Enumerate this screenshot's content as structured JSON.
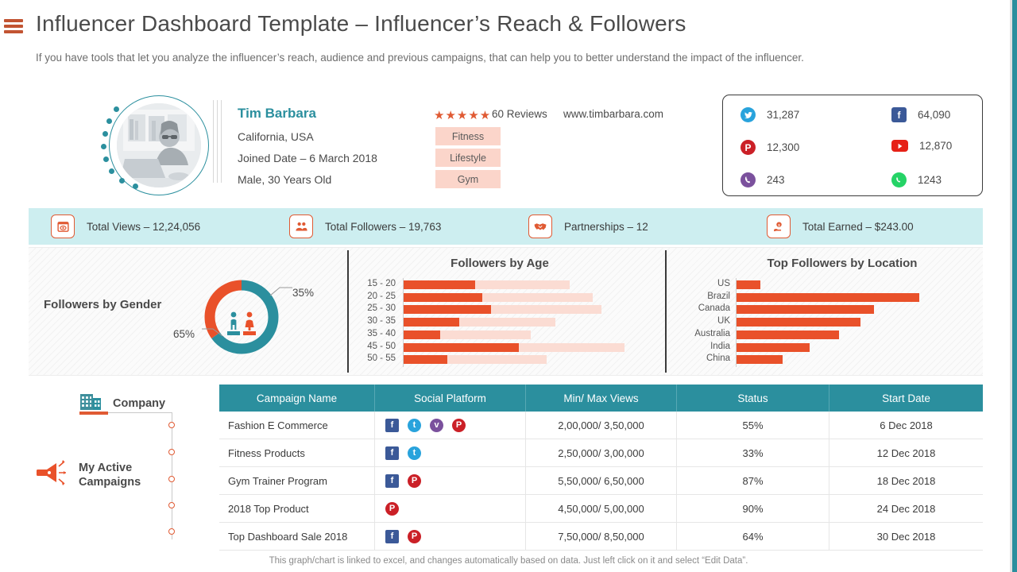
{
  "header": {
    "title": "Influencer Dashboard Template – Influencer’s Reach & Followers",
    "subtitle": "If you have tools that let you analyze the influencer’s reach, audience and previous campaigns, that can help you to better understand the impact of the influencer.",
    "menu_icon": "hamburger-icon"
  },
  "profile": {
    "name": "Tim Barbara",
    "location": "California, USA",
    "joined": "Joined Date – 6 March 2018",
    "demographics": "Male, 30 Years Old",
    "stars": "★★★★★",
    "reviews": "60 Reviews",
    "website": "www.timbarbara.com",
    "tags": [
      "Fitness",
      "Lifestyle",
      "Gym"
    ]
  },
  "social_stats": [
    {
      "network": "twitter",
      "icon": "twitter-icon",
      "value": "31,287",
      "color": "#29a3dc"
    },
    {
      "network": "facebook",
      "icon": "facebook-icon",
      "value": "64,090",
      "color": "#3b5998"
    },
    {
      "network": "pinterest",
      "icon": "pinterest-icon",
      "value": "12,300",
      "color": "#cb2027"
    },
    {
      "network": "youtube",
      "icon": "youtube-icon",
      "value": "12,870",
      "color": "#e62117"
    },
    {
      "network": "viber",
      "icon": "viber-icon",
      "value": "243",
      "color": "#7b519d"
    },
    {
      "network": "whatsapp",
      "icon": "whatsapp-icon",
      "value": "1243",
      "color": "#25d366"
    }
  ],
  "kpis": [
    {
      "icon": "eye-icon",
      "label": "Total Views – 12,24,056"
    },
    {
      "icon": "users-icon",
      "label": "Total Followers – 19,763"
    },
    {
      "icon": "handshake-icon",
      "label": "Partnerships – 12"
    },
    {
      "icon": "money-hand-icon",
      "label": "Total Earned – $243.00"
    }
  ],
  "chart_data": [
    {
      "type": "pie",
      "title": "Followers by Gender",
      "labels": [
        "Male",
        "Female"
      ],
      "values": [
        65,
        35
      ],
      "value_labels": [
        "65%",
        "35%"
      ],
      "colors": [
        "#2b8f9e",
        "#e9512a"
      ],
      "legend": "none",
      "donut": true
    },
    {
      "type": "bar",
      "title": "Followers by Age",
      "orientation": "horizontal",
      "categories": [
        "15 - 20",
        "20 - 25",
        "25 - 30",
        "30 - 35",
        "35 - 40",
        "45 - 50",
        "50 - 55"
      ],
      "values": [
        31,
        34,
        38,
        24,
        16,
        50,
        19
      ],
      "track_values": [
        72,
        82,
        86,
        66,
        55,
        96,
        62
      ],
      "xlabel": "",
      "ylabel": "",
      "xlim": [
        0,
        100
      ],
      "grid": false,
      "colors": {
        "fill": "#e9512a",
        "track": "#fbdcd3"
      }
    },
    {
      "type": "bar",
      "title": "Top Followers by Location",
      "orientation": "horizontal",
      "categories": [
        "US",
        "Brazil",
        "Canada",
        "UK",
        "Australia",
        "India",
        "China"
      ],
      "values": [
        13,
        100,
        75,
        68,
        56,
        40,
        25
      ],
      "xlabel": "",
      "ylabel": "",
      "xlim": [
        0,
        100
      ],
      "grid": false,
      "colors": {
        "fill": "#e9512a"
      }
    }
  ],
  "rail": {
    "company_label": "Company",
    "company_icon": "building-icon",
    "campaigns_label": "My Active\nCampaigns",
    "campaigns_icon": "megaphone-icon"
  },
  "table": {
    "columns": [
      "Campaign Name",
      "Social Platform",
      "Min/ Max Views",
      "Status",
      "Start Date"
    ],
    "rows": [
      {
        "name": "Fashion E Commerce",
        "platforms": [
          "facebook",
          "twitter",
          "viber",
          "pinterest"
        ],
        "views": "2,00,000/ 3,50,000",
        "status": "55%",
        "date": "6 Dec 2018"
      },
      {
        "name": "Fitness Products",
        "platforms": [
          "facebook",
          "twitter"
        ],
        "views": "2,50,000/ 3,00,000",
        "status": "33%",
        "date": "12 Dec 2018"
      },
      {
        "name": "Gym Trainer Program",
        "platforms": [
          "facebook",
          "pinterest"
        ],
        "views": "5,50,000/ 6,50,000",
        "status": "87%",
        "date": "18 Dec 2018"
      },
      {
        "name": "2018 Top Product",
        "platforms": [
          "pinterest"
        ],
        "views": "4,50,000/ 5,00,000",
        "status": "90%",
        "date": "24 Dec 2018"
      },
      {
        "name": "Top Dashboard Sale 2018",
        "platforms": [
          "facebook",
          "pinterest"
        ],
        "views": "7,50,000/ 8,50,000",
        "status": "64%",
        "date": "30 Dec 2018"
      }
    ]
  },
  "footer": {
    "note": "This graph/chart is linked to excel, and changes automatically based on data. Just left click on it and select “Edit Data”."
  },
  "colors": {
    "teal": "#2b8f9e",
    "orange": "#e9512a",
    "kpi_band": "#cdeef0",
    "tag_bg": "#fbd5ca"
  }
}
